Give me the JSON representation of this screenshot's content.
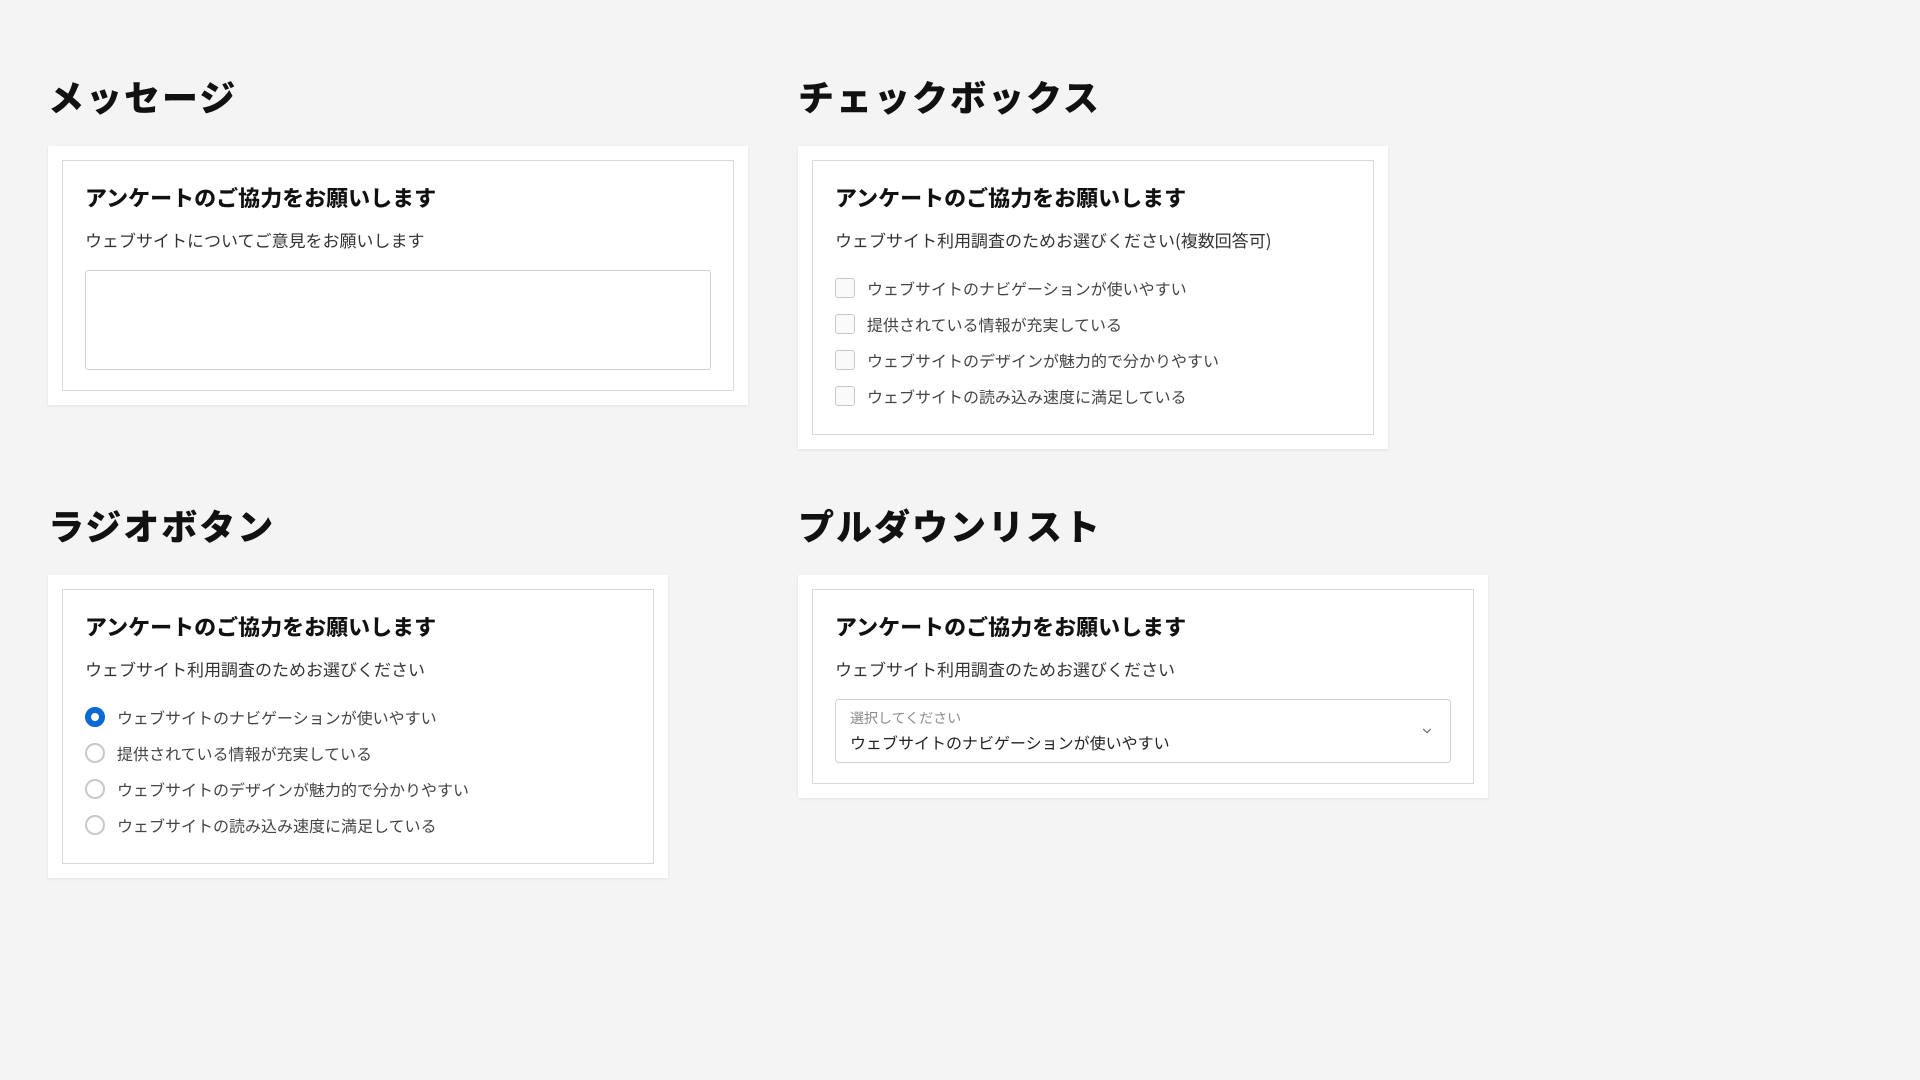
{
  "sections": {
    "message": {
      "heading": "メッセージ",
      "panel_title": "アンケートのご協力をお願いします",
      "desc": "ウェブサイトについてご意見をお願いします"
    },
    "checkbox": {
      "heading": "チェックボックス",
      "panel_title": "アンケートのご協力をお願いします",
      "desc": "ウェブサイト利用調査のためお選びください(複数回答可)",
      "options": [
        "ウェブサイトのナビゲーションが使いやすい",
        "提供されている情報が充実している",
        "ウェブサイトのデザインが魅力的で分かりやすい",
        "ウェブサイトの読み込み速度に満足している"
      ]
    },
    "radio": {
      "heading": "ラジオボタン",
      "panel_title": "アンケートのご協力をお願いします",
      "desc": "ウェブサイト利用調査のためお選びください",
      "options": [
        "ウェブサイトのナビゲーションが使いやすい",
        "提供されている情報が充実している",
        "ウェブサイトのデザインが魅力的で分かりやすい",
        "ウェブサイトの読み込み速度に満足している"
      ],
      "selected_index": 0
    },
    "pulldown": {
      "heading": "プルダウンリスト",
      "panel_title": "アンケートのご協力をお願いします",
      "desc": "ウェブサイト利用調査のためお選びください",
      "placeholder": "選択してください",
      "value": "ウェブサイトのナビゲーションが使いやすい"
    }
  }
}
